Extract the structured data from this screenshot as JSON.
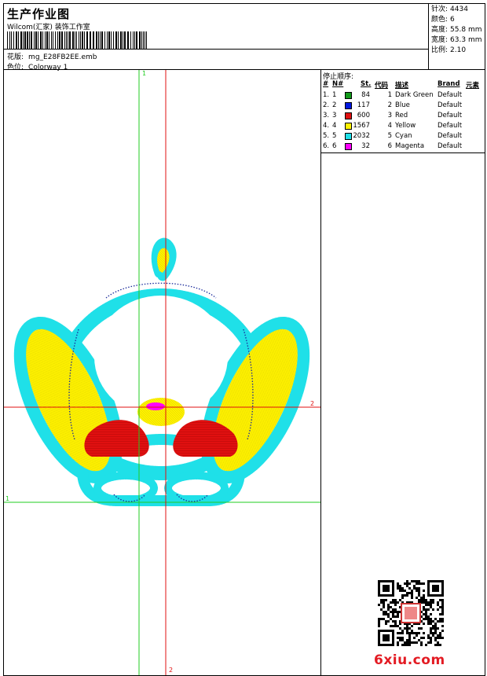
{
  "header": {
    "title": "生产作业图",
    "subtitle": "Wilcom(汇家) 装饰工作室",
    "design_label": "花版:",
    "design_value": "mg_E28FB2EE.emb",
    "colorway_label": "色位:",
    "colorway_value": "Colorway 1"
  },
  "stats": [
    {
      "label": "针次:",
      "value": "4434"
    },
    {
      "label": "颜色:",
      "value": "6"
    },
    {
      "label": "高度:",
      "value": "55.8 mm"
    },
    {
      "label": "宽度:",
      "value": "63.3 mm"
    },
    {
      "label": "比例:",
      "value": "2.10"
    }
  ],
  "stop_sequence": {
    "title": "停止顺序:",
    "columns": {
      "num": "#",
      "needle": "N#",
      "stitches": "St.",
      "code": "代码",
      "desc": "描述",
      "brand": "Brand",
      "element": "元素"
    },
    "rows": [
      {
        "num": "1.",
        "needle": "1",
        "color": "#129a1a",
        "stitches": "84",
        "code": "1",
        "desc": "Dark Green",
        "brand": "Default"
      },
      {
        "num": "2.",
        "needle": "2",
        "color": "#0018e0",
        "stitches": "117",
        "code": "2",
        "desc": "Blue",
        "brand": "Default"
      },
      {
        "num": "3.",
        "needle": "3",
        "color": "#e01010",
        "stitches": "600",
        "code": "3",
        "desc": "Red",
        "brand": "Default"
      },
      {
        "num": "4.",
        "needle": "4",
        "color": "#fff200",
        "stitches": "1567",
        "code": "4",
        "desc": "Yellow",
        "brand": "Default"
      },
      {
        "num": "5.",
        "needle": "5",
        "color": "#1fe0e8",
        "stitches": "2032",
        "code": "5",
        "desc": "Cyan",
        "brand": "Default"
      },
      {
        "num": "6.",
        "needle": "6",
        "color": "#ff00ff",
        "stitches": "32",
        "code": "6",
        "desc": "Magenta",
        "brand": "Default"
      }
    ]
  },
  "guides": {
    "green_label": "1",
    "red_label": "2",
    "green_color": "#22cc22",
    "red_color": "#e01010"
  },
  "watermark": "6xiu.com"
}
